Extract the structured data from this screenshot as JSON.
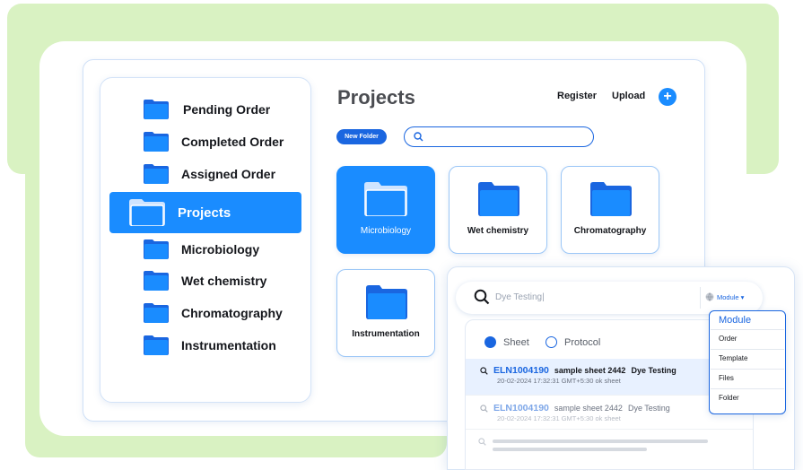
{
  "sidebar": {
    "items": [
      {
        "label": "Pending Order",
        "active": false
      },
      {
        "label": "Completed Order",
        "active": false
      },
      {
        "label": "Assigned Order",
        "active": false
      },
      {
        "label": "Projects",
        "active": true
      },
      {
        "label": "Microbiology",
        "active": false
      },
      {
        "label": "Wet chemistry",
        "active": false
      },
      {
        "label": "Chromatography",
        "active": false
      },
      {
        "label": "Instrumentation",
        "active": false
      }
    ]
  },
  "main": {
    "title": "Projects",
    "register_label": "Register",
    "upload_label": "Upload",
    "add_label": "+",
    "new_folder_label": "New Folder",
    "search_value": "",
    "folders": [
      {
        "label": "Microbiology",
        "active": true
      },
      {
        "label": "Wet chemistry",
        "active": false
      },
      {
        "label": "Chromatography",
        "active": false
      },
      {
        "label": "Instrumentation",
        "active": false
      }
    ]
  },
  "search_panel": {
    "query": "Dye Testing|",
    "module_label": "Module ▾",
    "filters": [
      {
        "label": "Sheet",
        "selected": true
      },
      {
        "label": "Protocol",
        "selected": false
      }
    ],
    "results": [
      {
        "code": "ELN1004190",
        "name": "sample sheet 2442",
        "tag": "Dye Testing",
        "meta": "20-02-2024 17:32:31 GMT+5:30 ok sheet"
      },
      {
        "code": "ELN1004190",
        "name": "sample sheet 2442",
        "tag": "Dye Testing",
        "meta": "20-02-2024 17:32:31 GMT+5:30 ok sheet"
      }
    ],
    "module_menu": {
      "title": "Module",
      "items": [
        "Order",
        "Template",
        "Files",
        "Folder"
      ]
    }
  },
  "colors": {
    "accent": "#1a8cff",
    "accent_dark": "#1a66e0",
    "background_green": "#d9f2c2"
  },
  "icons": [
    "folder-icon",
    "search-icon",
    "plus-icon",
    "globe-icon"
  ]
}
